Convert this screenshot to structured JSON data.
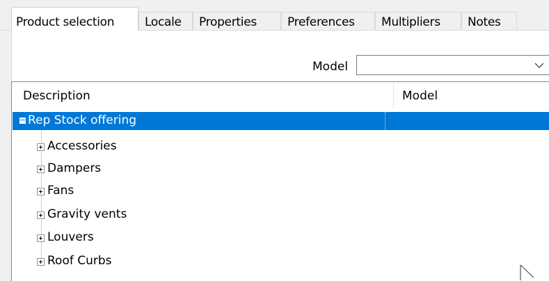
{
  "tabs": [
    {
      "label": "Product selection",
      "active": true
    },
    {
      "label": "Locale",
      "active": false
    },
    {
      "label": "Properties",
      "active": false
    },
    {
      "label": "Preferences",
      "active": false
    },
    {
      "label": "Multipliers",
      "active": false
    },
    {
      "label": "Notes",
      "active": false
    }
  ],
  "filter": {
    "model_label": "Model",
    "model_value": ""
  },
  "tree": {
    "columns": [
      "Description",
      "Model"
    ],
    "root": {
      "label": "Rep Stock offering",
      "model": "",
      "expanded": true,
      "selected": true
    },
    "items": [
      {
        "label": "Accessories"
      },
      {
        "label": "Dampers"
      },
      {
        "label": "Fans"
      },
      {
        "label": "Gravity vents"
      },
      {
        "label": "Louvers"
      },
      {
        "label": "Roof Curbs"
      }
    ]
  },
  "colors": {
    "selection": "#0078d7",
    "panel_bg": "#ffffff",
    "window_bg": "#f0f0f0"
  },
  "icons": [
    "minus-box-icon",
    "plus-box-icon",
    "chevron-down-icon",
    "mouse-pointer-icon"
  ]
}
